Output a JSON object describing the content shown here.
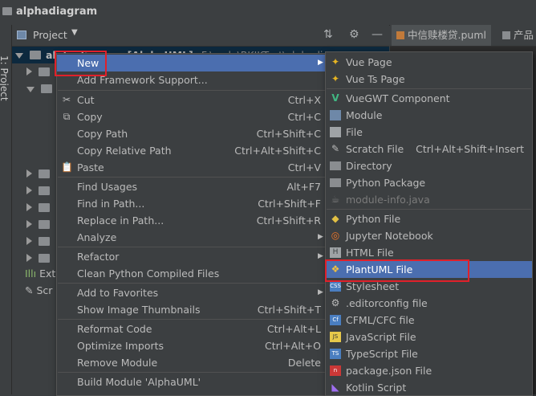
{
  "window": {
    "title": "alphadiagram"
  },
  "side_strip": {
    "label": "1: Project"
  },
  "project_panel": {
    "title": "Project",
    "toolbar_icons": [
      "collapse-icon",
      "gear-icon",
      "minimize-icon"
    ]
  },
  "editor_tabs": [
    {
      "label": "中信赎楼贷.puml"
    },
    {
      "label": "产品"
    }
  ],
  "tree": {
    "root_label": "alphadiagram [AlphaUML]",
    "root_path": "F:\\code\\BKJKTest\\alphadiagram",
    "partial_rows": [
      {
        "label": "Exte"
      },
      {
        "label": "Scr"
      }
    ]
  },
  "context_menu": {
    "items": [
      {
        "label": "New",
        "shortcut": "",
        "submenu": true,
        "icon": "",
        "highlighted": true
      },
      {
        "label": "Add Framework Support...",
        "shortcut": "",
        "icon": ""
      },
      {
        "label": "Cut",
        "shortcut": "Ctrl+X",
        "icon": "scissors-icon"
      },
      {
        "label": "Copy",
        "shortcut": "Ctrl+C",
        "icon": "copy-icon"
      },
      {
        "label": "Copy Path",
        "shortcut": "Ctrl+Shift+C",
        "icon": ""
      },
      {
        "label": "Copy Relative Path",
        "shortcut": "Ctrl+Alt+Shift+C",
        "icon": ""
      },
      {
        "label": "Paste",
        "shortcut": "Ctrl+V",
        "icon": "paste-icon"
      },
      {
        "label": "Find Usages",
        "shortcut": "Alt+F7",
        "icon": ""
      },
      {
        "label": "Find in Path...",
        "shortcut": "Ctrl+Shift+F",
        "icon": ""
      },
      {
        "label": "Replace in Path...",
        "shortcut": "Ctrl+Shift+R",
        "icon": ""
      },
      {
        "label": "Analyze",
        "shortcut": "",
        "submenu": true,
        "icon": ""
      },
      {
        "label": "Refactor",
        "shortcut": "",
        "submenu": true,
        "icon": ""
      },
      {
        "label": "Clean Python Compiled Files",
        "shortcut": "",
        "icon": ""
      },
      {
        "label": "Add to Favorites",
        "shortcut": "",
        "submenu": true,
        "icon": ""
      },
      {
        "label": "Show Image Thumbnails",
        "shortcut": "Ctrl+Shift+T",
        "icon": ""
      },
      {
        "label": "Reformat Code",
        "shortcut": "Ctrl+Alt+L",
        "icon": ""
      },
      {
        "label": "Optimize Imports",
        "shortcut": "Ctrl+Alt+O",
        "icon": ""
      },
      {
        "label": "Remove Module",
        "shortcut": "Delete",
        "icon": ""
      },
      {
        "label": "Build Module 'AlphaUML'",
        "shortcut": "",
        "icon": ""
      }
    ]
  },
  "new_submenu": {
    "items": [
      {
        "label": "Vue Page",
        "shortcut": "",
        "icon": "vue-icon"
      },
      {
        "label": "Vue Ts Page",
        "shortcut": "",
        "icon": "vue-icon"
      },
      {
        "label": "VueGWT Component",
        "shortcut": "",
        "icon": "vuegwt-icon"
      },
      {
        "label": "Module",
        "shortcut": "",
        "icon": "module-icon"
      },
      {
        "label": "File",
        "shortcut": "",
        "icon": "file-icon"
      },
      {
        "label": "Scratch File",
        "shortcut": "Ctrl+Alt+Shift+Insert",
        "icon": "scratch-file-icon"
      },
      {
        "label": "Directory",
        "shortcut": "",
        "icon": "folder-icon"
      },
      {
        "label": "Python Package",
        "shortcut": "",
        "icon": "python-package-icon"
      },
      {
        "label": "module-info.java",
        "shortcut": "",
        "icon": "java-icon",
        "disabled": true
      },
      {
        "label": "Python File",
        "shortcut": "",
        "icon": "python-icon"
      },
      {
        "label": "Jupyter Notebook",
        "shortcut": "",
        "icon": "jupyter-icon"
      },
      {
        "label": "HTML File",
        "shortcut": "",
        "icon": "html-icon"
      },
      {
        "label": "PlantUML File",
        "shortcut": "",
        "icon": "plantuml-icon",
        "highlighted": true
      },
      {
        "label": "Stylesheet",
        "shortcut": "",
        "icon": "css-icon"
      },
      {
        "label": ".editorconfig file",
        "shortcut": "",
        "icon": "gear-icon"
      },
      {
        "label": "CFML/CFC file",
        "shortcut": "",
        "icon": "cfml-icon"
      },
      {
        "label": "JavaScript File",
        "shortcut": "",
        "icon": "js-icon"
      },
      {
        "label": "TypeScript File",
        "shortcut": "",
        "icon": "ts-icon"
      },
      {
        "label": "package.json File",
        "shortcut": "",
        "icon": "npm-icon"
      },
      {
        "label": "Kotlin Script",
        "shortcut": "",
        "icon": "kotlin-icon"
      }
    ]
  },
  "colors": {
    "menu_bg": "#3c3f41",
    "highlight": "#4b6eaf",
    "annotation_box": "#e0202a"
  }
}
